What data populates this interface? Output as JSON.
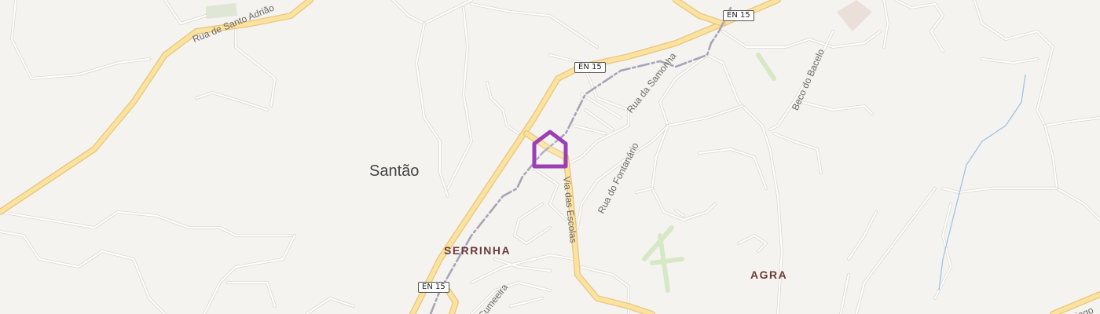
{
  "map": {
    "places": {
      "town": "Santão",
      "serrinha": "SERRINHA",
      "agra": "AGRA"
    },
    "streets": {
      "santo_adriao": "Rua de Santo Adrião",
      "samonha": "Rua da Samonha",
      "bacelo": "Beco do Bacelo",
      "fontanario": "Rua do Fontanário",
      "escolas": "Via das Escolas",
      "cumeeira": "Cumeeira",
      "partial_right": "ntiago"
    },
    "road_shields": [
      "EN 15",
      "EN 15",
      "EN 15"
    ],
    "marker": {
      "icon": "home-icon",
      "color": "#9b3fb5"
    }
  }
}
